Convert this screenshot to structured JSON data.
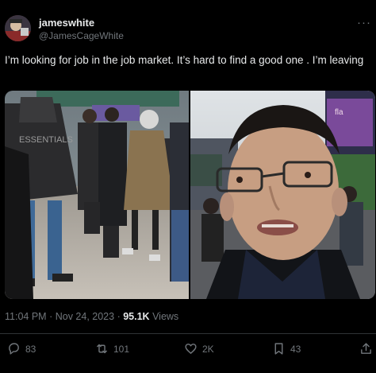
{
  "author": {
    "name": "jameswhite",
    "handle": "@JamesCageWhite"
  },
  "tweet": {
    "text": "I’m looking for job in the job market. It’s hard to find a good one . I’m leaving"
  },
  "meta": {
    "time": "11:04 PM",
    "separator": "·",
    "date": "Nov 24, 2023",
    "views_count": "95.1K",
    "views_label": "Views"
  },
  "photo_left": {
    "jacket_text": "ESSENTIALS"
  },
  "photo_right": {
    "sign_text": "fla"
  },
  "actions": {
    "reply_count": "83",
    "retweet_count": "101",
    "like_count": "2K",
    "bookmark_count": "43"
  },
  "icons": [
    "more-icon",
    "reply-icon",
    "retweet-icon",
    "like-icon",
    "bookmark-icon",
    "share-icon"
  ],
  "colors": {
    "background": "#000000",
    "text_primary": "#e7e9ea",
    "text_secondary": "#71767b",
    "divider": "#2f3336"
  }
}
